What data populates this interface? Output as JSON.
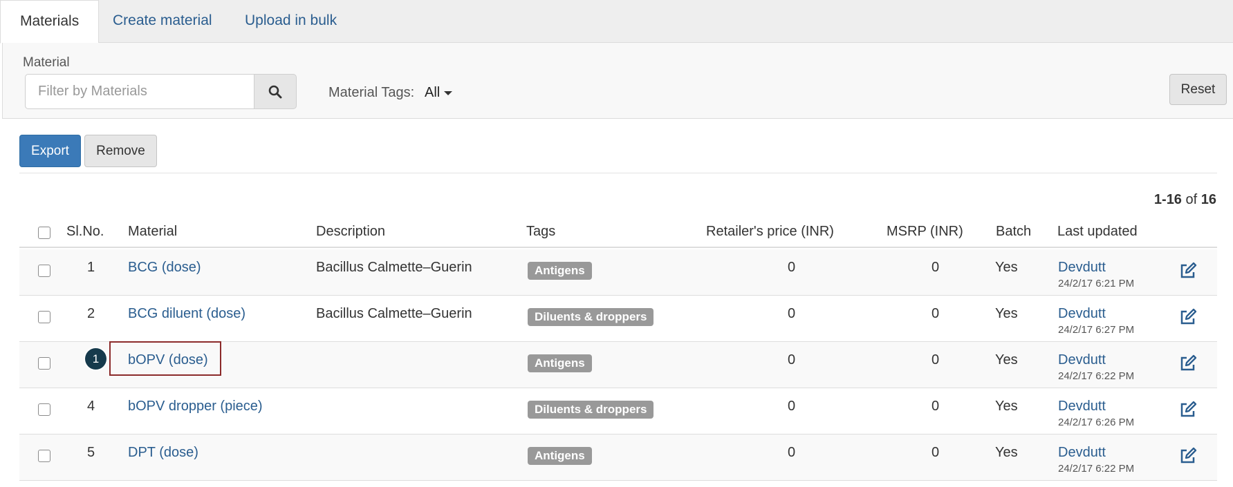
{
  "tabs": [
    {
      "label": "Materials",
      "active": true
    },
    {
      "label": "Create material",
      "active": false
    },
    {
      "label": "Upload in bulk",
      "active": false
    }
  ],
  "filter": {
    "label": "Material",
    "placeholder": "Filter by Materials",
    "tags_label": "Material Tags:",
    "tags_value": "All",
    "reset_label": "Reset"
  },
  "actions": {
    "export_label": "Export",
    "remove_label": "Remove"
  },
  "pagination": {
    "start": "1",
    "end": "16",
    "of": "of",
    "total": "16"
  },
  "table": {
    "headers": {
      "slno": "Sl.No.",
      "material": "Material",
      "description": "Description",
      "tags": "Tags",
      "retailer_price": "Retailer's price (INR)",
      "msrp": "MSRP (INR)",
      "batch": "Batch",
      "last_updated": "Last updated"
    },
    "rows": [
      {
        "slno": "1",
        "material": "BCG (dose)",
        "description": "Bacillus Calmette–Guerin",
        "tag": "Antigens",
        "retailer_price": "0",
        "msrp": "0",
        "batch": "Yes",
        "updated_by": "Devdutt",
        "updated_at": "24/2/17 6:21 PM"
      },
      {
        "slno": "2",
        "material": "BCG diluent (dose)",
        "description": "Bacillus Calmette–Guerin",
        "tag": "Diluents & droppers",
        "retailer_price": "0",
        "msrp": "0",
        "batch": "Yes",
        "updated_by": "Devdutt",
        "updated_at": "24/2/17 6:27 PM"
      },
      {
        "slno": "",
        "material": "bOPV (dose)",
        "description": "",
        "tag": "Antigens",
        "retailer_price": "0",
        "msrp": "0",
        "batch": "Yes",
        "updated_by": "Devdutt",
        "updated_at": "24/2/17 6:22 PM"
      },
      {
        "slno": "4",
        "material": "bOPV dropper (piece)",
        "description": "",
        "tag": "Diluents & droppers",
        "retailer_price": "0",
        "msrp": "0",
        "batch": "Yes",
        "updated_by": "Devdutt",
        "updated_at": "24/2/17 6:26 PM"
      },
      {
        "slno": "5",
        "material": "DPT (dose)",
        "description": "",
        "tag": "Antigens",
        "retailer_price": "0",
        "msrp": "0",
        "batch": "Yes",
        "updated_by": "Devdutt",
        "updated_at": "24/2/17 6:22 PM"
      }
    ]
  },
  "annotation": {
    "step_number": "1"
  },
  "colors": {
    "link": "#2a5d8f",
    "primary": "#3b7ab8",
    "tag": "#999999",
    "highlight": "#8b2a2a",
    "badge": "#163a4c"
  }
}
